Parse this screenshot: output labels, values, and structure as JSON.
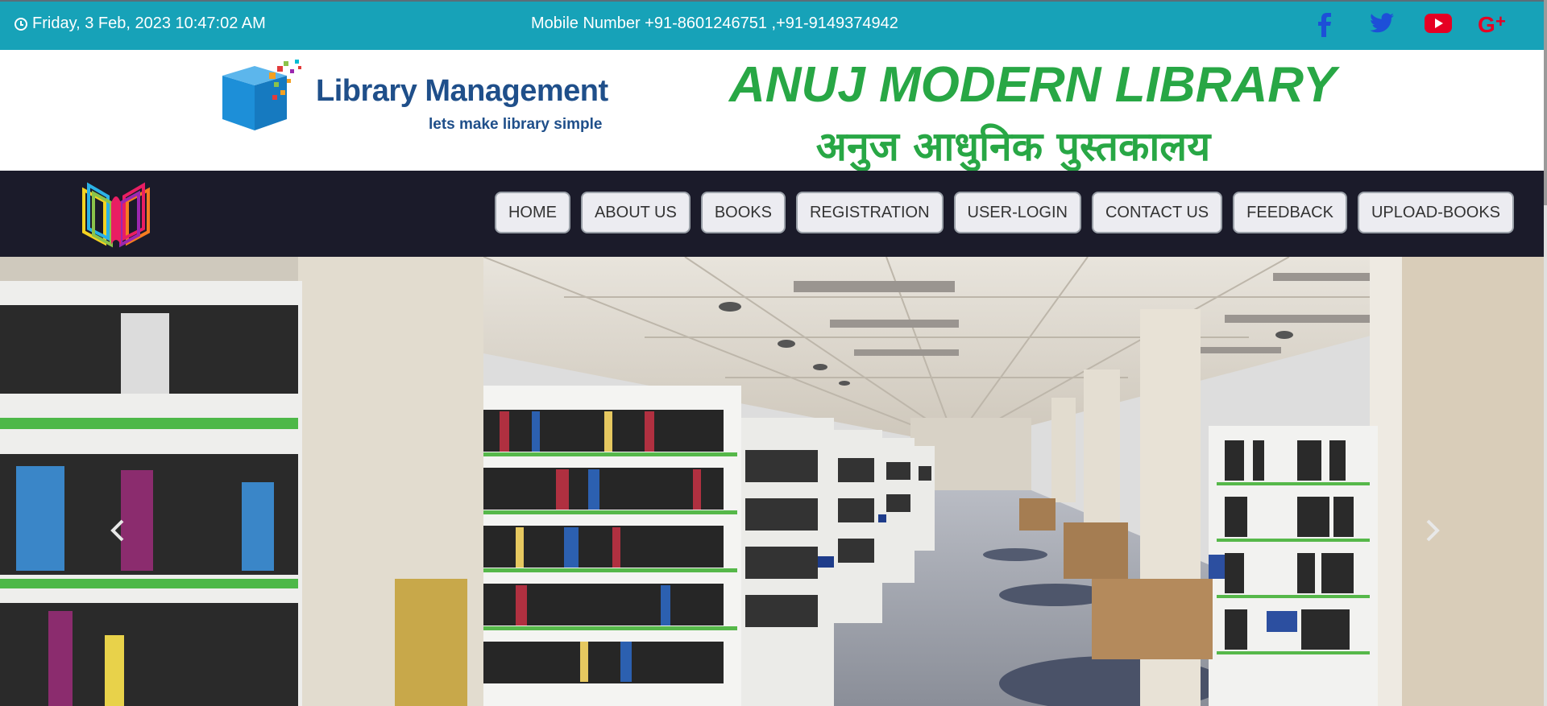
{
  "topbar": {
    "datetime": "Friday, 3 Feb, 2023 10:47:02 AM",
    "mobile": "Mobile Number +91-8601246751 ,+91-9149374942",
    "social": [
      {
        "name": "facebook-icon",
        "color": "#1d4fd8"
      },
      {
        "name": "twitter-icon",
        "color": "#1d4fd8"
      },
      {
        "name": "youtube-icon",
        "color": "#e60023"
      },
      {
        "name": "google-plus-icon",
        "color": "#e60023"
      }
    ]
  },
  "header": {
    "logo_title": "Library Management",
    "logo_subtitle": "lets make library simple",
    "site_title": "ANUJ MODERN LIBRARY",
    "site_subtitle": "अनुज आधुनिक पुस्तकालय"
  },
  "nav": {
    "items": [
      {
        "label": "HOME"
      },
      {
        "label": "ABOUT US"
      },
      {
        "label": "BOOKS"
      },
      {
        "label": "REGISTRATION"
      },
      {
        "label": "USER-LOGIN"
      },
      {
        "label": "CONTACT US"
      },
      {
        "label": "FEEDBACK"
      },
      {
        "label": "UPLOAD-BOOKS"
      }
    ]
  },
  "colors": {
    "topbar_bg": "#17a2b8",
    "title_green": "#28a745",
    "navbar_bg": "#1b1b2a",
    "logo_blue": "#1f4f8a"
  }
}
